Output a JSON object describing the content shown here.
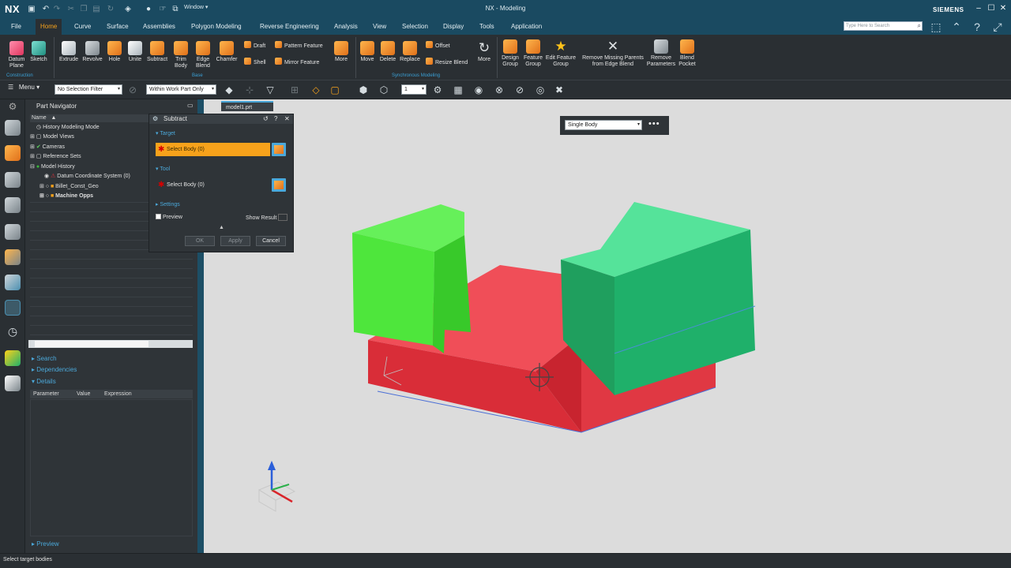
{
  "app": {
    "logo": "NX",
    "window_menu": "Window",
    "title": "NX - Modeling",
    "brand": "SIEMENS"
  },
  "menu_tabs": [
    "File",
    "Home",
    "Curve",
    "Surface",
    "Assemblies",
    "Polygon Modeling",
    "Reverse Engineering",
    "Analysis",
    "View",
    "Selection",
    "Display",
    "Tools",
    "Application"
  ],
  "active_tab": "Home",
  "search": {
    "placeholder": "Type Here to Search"
  },
  "ribbon": {
    "datum_plane": "Datum Plane",
    "sketch": "Sketch",
    "extrude": "Extrude",
    "revolve": "Revolve",
    "hole": "Hole",
    "unite": "Unite",
    "subtract": "Subtract",
    "trim_body": "Trim Body",
    "edge_blend": "Edge Blend",
    "chamfer": "Chamfer",
    "draft": "Draft",
    "shell": "Shell",
    "pattern_feature": "Pattern Feature",
    "mirror_feature": "Mirror Feature",
    "more1": "More",
    "move": "Move",
    "delete": "Delete",
    "replace": "Replace",
    "offset": "Offset",
    "resize_blend": "Resize Blend",
    "more2": "More",
    "design_group": "Design Group",
    "feature_group": "Feature Group",
    "edit_feature_group": "Edit Feature Group",
    "remove_missing": "Remove Missing Parents from Edge Blend",
    "remove_parameters": "Remove Parameters",
    "blend_pocket": "Blend Pocket",
    "group_construction": "Construction",
    "group_base": "Base",
    "group_sync": "Synchronous Modeling"
  },
  "toolbar": {
    "menu": "Menu",
    "selection_filter": "No Selection Filter",
    "scope": "Within Work Part Only",
    "layer": "1"
  },
  "navigator": {
    "title": "Part Navigator",
    "col_name": "Name",
    "items": [
      "History Modeling Mode",
      "Model Views",
      "Cameras",
      "Reference Sets",
      "Model History",
      "Datum Coordinate System (0)",
      "Billet_Const_Geo",
      "Machine Opps"
    ],
    "search": "Search",
    "dependencies": "Dependencies",
    "details": "Details",
    "detail_cols": [
      "Parameter",
      "Value",
      "Expression"
    ],
    "preview": "Preview"
  },
  "graphics_tab": "model1.prt",
  "dialog": {
    "title": "Subtract",
    "target_label": "Target",
    "target_select": "Select Body (0)",
    "tool_label": "Tool",
    "tool_select": "Select Body (0)",
    "settings_label": "Settings",
    "preview": "Preview",
    "show_result": "Show Result",
    "ok": "OK",
    "apply": "Apply",
    "cancel": "Cancel"
  },
  "body_selector": {
    "value": "Single Body"
  },
  "status": "Select target bodies",
  "colors": {
    "accent": "#f7a21b",
    "titlebar": "#1a4a61",
    "panel": "#2f3438",
    "red_body": "#e0333c",
    "green_body": "#4ee63c",
    "teal_body": "#1fb06a"
  }
}
